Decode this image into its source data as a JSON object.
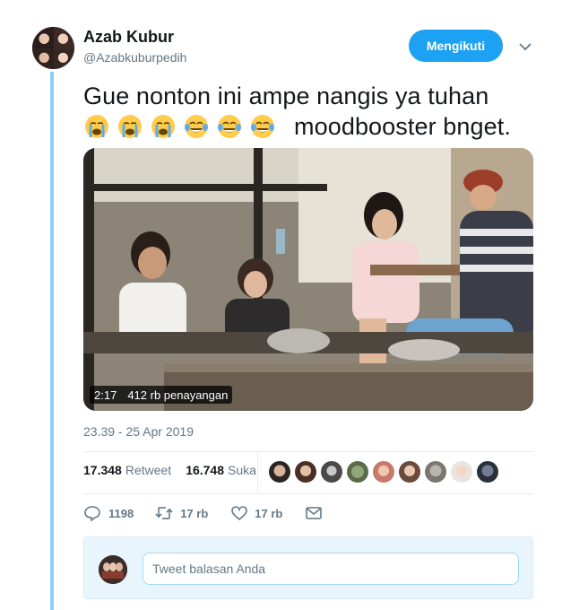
{
  "author": {
    "name": "Azab Kubur",
    "handle": "@Azabkuburpedih"
  },
  "follow_button_label": "Mengikuti",
  "tweet": {
    "line1": "Gue nonton ini ampe nangis ya tuhan",
    "emojis": [
      "crying-face",
      "crying-face",
      "crying-face",
      "tears-of-joy",
      "tears-of-joy",
      "tears-of-joy"
    ],
    "line2_after_emoji": "moodbooster bnget."
  },
  "video": {
    "duration": "2:17",
    "views": "412 rb penayangan"
  },
  "timestamp": "23.39 - 25 Apr 2019",
  "stats": {
    "retweets_count": "17.348",
    "retweets_label": "Retweet",
    "likes_count": "16.748",
    "likes_label": "Suka"
  },
  "liker_avatar_count": 9,
  "actions": {
    "reply_count": "1198",
    "retweet_count": "17 rb",
    "like_count": "17 rb"
  },
  "reply_box": {
    "placeholder": "Tweet balasan Anda"
  },
  "colors": {
    "accent": "#1da1f2",
    "thread_line": "#8ecdf8",
    "muted_text": "#657786",
    "reply_bg": "#e8f5fd"
  }
}
